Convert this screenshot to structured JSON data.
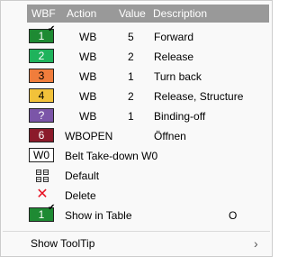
{
  "header": {
    "wbf": "WBF",
    "action": "Action",
    "value": "Value",
    "description": "Description"
  },
  "rows": [
    {
      "symbol": "1",
      "action": "WB",
      "value": "5",
      "description": "Forward",
      "color": "#1e8a33",
      "text_color": "#ffffff",
      "checked": true
    },
    {
      "symbol": "2",
      "action": "WB",
      "value": "2",
      "description": "Release",
      "color": "#1fb35c",
      "text_color": "#ffffff",
      "checked": false
    },
    {
      "symbol": "3",
      "action": "WB",
      "value": "1",
      "description": "Turn back",
      "color": "#f07d3c",
      "text_color": "#000000",
      "checked": false
    },
    {
      "symbol": "4",
      "action": "WB",
      "value": "2",
      "description": "Release, Structure",
      "color": "#f2c23a",
      "text_color": "#000000",
      "checked": false
    },
    {
      "symbol": "?",
      "action": "WB",
      "value": "1",
      "description": "Binding-off",
      "color": "#7b55a8",
      "text_color": "#ffffff",
      "checked": false
    },
    {
      "symbol": "6",
      "action": "WBOPEN",
      "value": "",
      "description": "Öffnen",
      "color": "#8b1a2a",
      "text_color": "#ffffff",
      "checked": false
    }
  ],
  "belt": {
    "symbol": "W0",
    "label": "Belt Take-down W0"
  },
  "default_item": {
    "label": "Default",
    "icon": "grid-icon"
  },
  "delete_item": {
    "label": "Delete",
    "icon": "close-icon",
    "icon_glyph": "✕"
  },
  "show_in_table": {
    "symbol": "1",
    "label": "Show in Table",
    "shortcut": "O",
    "color": "#1e8a33"
  },
  "tooltip": {
    "label": "Show ToolTip",
    "chevron": "›"
  },
  "check_glyph": "✔"
}
